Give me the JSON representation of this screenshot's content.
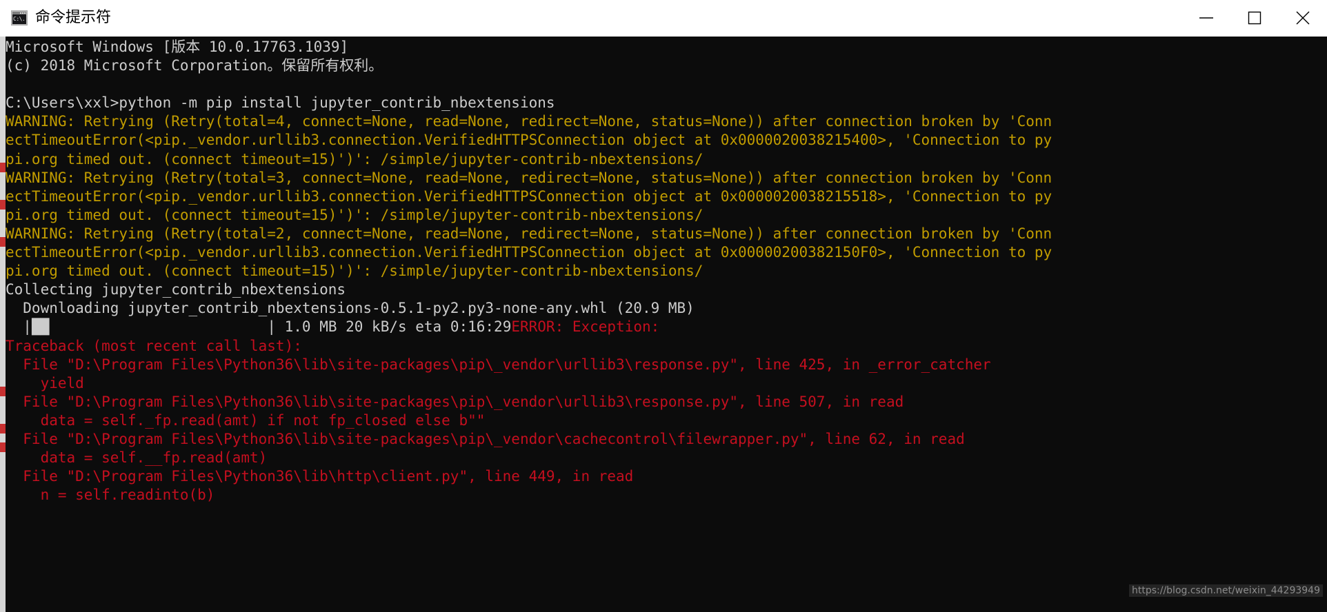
{
  "window": {
    "title": "命令提示符",
    "icon_name": "cmd-icon",
    "icon_text": "C:\\.",
    "controls": {
      "minimize_label": "最小化",
      "maximize_label": "最大化",
      "close_label": "关闭"
    }
  },
  "terminal": {
    "background": "#0c0c0c",
    "fg_white": "#cccccc",
    "fg_yellow": "#c19c00",
    "fg_red": "#c50f1f",
    "lines": [
      {
        "text": "Microsoft Windows [版本 10.0.17763.1039]",
        "color": "white"
      },
      {
        "text": "(c) 2018 Microsoft Corporation。保留所有权利。",
        "color": "white"
      },
      {
        "text": "",
        "color": "white"
      },
      {
        "text": "C:\\Users\\xxl>python -m pip install jupyter_contrib_nbextensions",
        "color": "white"
      },
      {
        "text": "WARNING: Retrying (Retry(total=4, connect=None, read=None, redirect=None, status=None)) after connection broken by 'Conn",
        "color": "yellow"
      },
      {
        "text": "ectTimeoutError(<pip._vendor.urllib3.connection.VerifiedHTTPSConnection object at 0x0000020038215400>, 'Connection to py",
        "color": "yellow"
      },
      {
        "text": "pi.org timed out. (connect timeout=15)')': /simple/jupyter-contrib-nbextensions/",
        "color": "yellow"
      },
      {
        "text": "WARNING: Retrying (Retry(total=3, connect=None, read=None, redirect=None, status=None)) after connection broken by 'Conn",
        "color": "yellow"
      },
      {
        "text": "ectTimeoutError(<pip._vendor.urllib3.connection.VerifiedHTTPSConnection object at 0x0000020038215518>, 'Connection to py",
        "color": "yellow"
      },
      {
        "text": "pi.org timed out. (connect timeout=15)')': /simple/jupyter-contrib-nbextensions/",
        "color": "yellow"
      },
      {
        "text": "WARNING: Retrying (Retry(total=2, connect=None, read=None, redirect=None, status=None)) after connection broken by 'Conn",
        "color": "yellow"
      },
      {
        "text": "ectTimeoutError(<pip._vendor.urllib3.connection.VerifiedHTTPSConnection object at 0x00000200382150F0>, 'Connection to py",
        "color": "yellow"
      },
      {
        "text": "pi.org timed out. (connect timeout=15)')': /simple/jupyter-contrib-nbextensions/",
        "color": "yellow"
      },
      {
        "text": "Collecting jupyter_contrib_nbextensions",
        "color": "white"
      },
      {
        "text": "  Downloading jupyter_contrib_nbextensions-0.5.1-py2.py3-none-any.whl (20.9 MB)",
        "color": "white"
      },
      {
        "text": "PROGRESS_LINE",
        "color": "white"
      },
      {
        "text": "Traceback (most recent call last):",
        "color": "red"
      },
      {
        "text": "  File \"D:\\Program Files\\Python36\\lib\\site-packages\\pip\\_vendor\\urllib3\\response.py\", line 425, in _error_catcher",
        "color": "red"
      },
      {
        "text": "    yield",
        "color": "red"
      },
      {
        "text": "  File \"D:\\Program Files\\Python36\\lib\\site-packages\\pip\\_vendor\\urllib3\\response.py\", line 507, in read",
        "color": "red"
      },
      {
        "text": "    data = self._fp.read(amt) if not fp_closed else b\"\"",
        "color": "red"
      },
      {
        "text": "  File \"D:\\Program Files\\Python36\\lib\\site-packages\\pip\\_vendor\\cachecontrol\\filewrapper.py\", line 62, in read",
        "color": "red"
      },
      {
        "text": "    data = self.__fp.read(amt)",
        "color": "red"
      },
      {
        "text": "  File \"D:\\Program Files\\Python36\\lib\\http\\client.py\", line 449, in read",
        "color": "red"
      },
      {
        "text": "    n = self.readinto(b)",
        "color": "red"
      }
    ],
    "progress": {
      "prefix": "  ",
      "bar_open": "|",
      "blocks": "██",
      "spacer_width_chars": 25,
      "bar_close": "|",
      "stats": " 1.0 MB 20 kB/s eta 0:16:29",
      "error_text": "ERROR: Exception:"
    }
  },
  "watermark": {
    "text": "https://blog.csdn.net/weixin_44293949"
  }
}
